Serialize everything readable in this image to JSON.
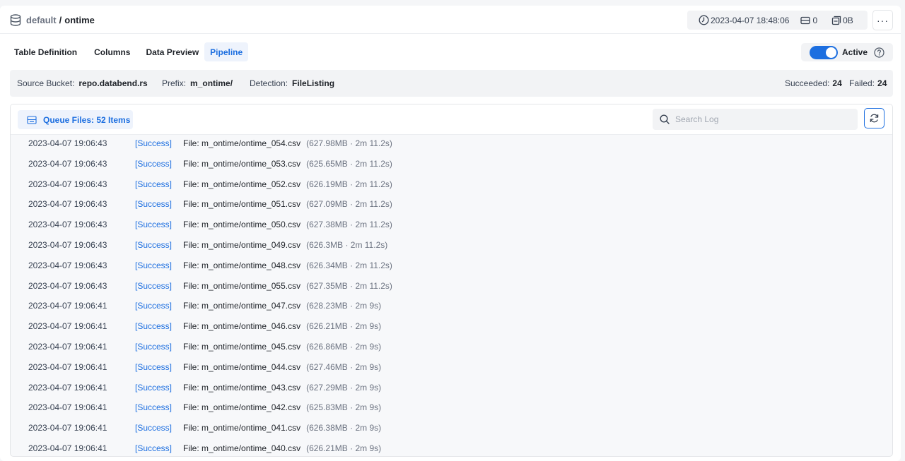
{
  "header": {
    "database": "default",
    "separator": "/",
    "table": "ontime",
    "timestamp": "2023-04-07 18:48:06",
    "row_count": "0",
    "size": "0B",
    "more_label": "···"
  },
  "tabs": [
    {
      "label": "Table Definition",
      "active": false
    },
    {
      "label": "Columns",
      "active": false
    },
    {
      "label": "Data Preview",
      "active": false
    },
    {
      "label": "Pipeline",
      "active": true
    }
  ],
  "pipeline": {
    "active_label": "Active",
    "active": true,
    "source_bucket_label": "Source Bucket:",
    "source_bucket": "repo.databend.rs",
    "prefix_label": "Prefix:",
    "prefix": "m_ontime/",
    "detection_label": "Detection:",
    "detection": "FileListing",
    "succeeded_label": "Succeeded:",
    "succeeded": "24",
    "failed_label": "Failed:",
    "failed": "24"
  },
  "log": {
    "queue_label": "Queue Files: 52 Items",
    "search_placeholder": "Search Log",
    "rows": [
      {
        "time": "2023-04-07 19:06:43",
        "status": "[Success]",
        "file": "File: m_ontime/ontime_054.csv",
        "meta": "(627.98MB · 2m 11.2s)"
      },
      {
        "time": "2023-04-07 19:06:43",
        "status": "[Success]",
        "file": "File: m_ontime/ontime_053.csv",
        "meta": "(625.65MB · 2m 11.2s)"
      },
      {
        "time": "2023-04-07 19:06:43",
        "status": "[Success]",
        "file": "File: m_ontime/ontime_052.csv",
        "meta": "(626.19MB · 2m 11.2s)"
      },
      {
        "time": "2023-04-07 19:06:43",
        "status": "[Success]",
        "file": "File: m_ontime/ontime_051.csv",
        "meta": "(627.09MB · 2m 11.2s)"
      },
      {
        "time": "2023-04-07 19:06:43",
        "status": "[Success]",
        "file": "File: m_ontime/ontime_050.csv",
        "meta": "(627.38MB · 2m 11.2s)"
      },
      {
        "time": "2023-04-07 19:06:43",
        "status": "[Success]",
        "file": "File: m_ontime/ontime_049.csv",
        "meta": "(626.3MB · 2m 11.2s)"
      },
      {
        "time": "2023-04-07 19:06:43",
        "status": "[Success]",
        "file": "File: m_ontime/ontime_048.csv",
        "meta": "(626.34MB · 2m 11.2s)"
      },
      {
        "time": "2023-04-07 19:06:43",
        "status": "[Success]",
        "file": "File: m_ontime/ontime_055.csv",
        "meta": "(627.35MB · 2m 11.2s)"
      },
      {
        "time": "2023-04-07 19:06:41",
        "status": "[Success]",
        "file": "File: m_ontime/ontime_047.csv",
        "meta": "(628.23MB · 2m 9s)"
      },
      {
        "time": "2023-04-07 19:06:41",
        "status": "[Success]",
        "file": "File: m_ontime/ontime_046.csv",
        "meta": "(626.21MB · 2m 9s)"
      },
      {
        "time": "2023-04-07 19:06:41",
        "status": "[Success]",
        "file": "File: m_ontime/ontime_045.csv",
        "meta": "(626.86MB · 2m 9s)"
      },
      {
        "time": "2023-04-07 19:06:41",
        "status": "[Success]",
        "file": "File: m_ontime/ontime_044.csv",
        "meta": "(627.46MB · 2m 9s)"
      },
      {
        "time": "2023-04-07 19:06:41",
        "status": "[Success]",
        "file": "File: m_ontime/ontime_043.csv",
        "meta": "(627.29MB · 2m 9s)"
      },
      {
        "time": "2023-04-07 19:06:41",
        "status": "[Success]",
        "file": "File: m_ontime/ontime_042.csv",
        "meta": "(625.83MB · 2m 9s)"
      },
      {
        "time": "2023-04-07 19:06:41",
        "status": "[Success]",
        "file": "File: m_ontime/ontime_041.csv",
        "meta": "(626.38MB · 2m 9s)"
      },
      {
        "time": "2023-04-07 19:06:41",
        "status": "[Success]",
        "file": "File: m_ontime/ontime_040.csv",
        "meta": "(626.21MB · 2m 9s)"
      }
    ]
  },
  "colors": {
    "accent": "#1d6fe0",
    "accent_bg": "#eef3fc",
    "panel_bg": "#f2f3f5"
  },
  "icons": {
    "database": "database-icon",
    "clock": "clock-icon",
    "rows": "rows-icon",
    "size": "storage-icon",
    "help": "help-icon",
    "queue": "inbox-icon",
    "search": "search-icon",
    "refresh": "refresh-icon"
  }
}
